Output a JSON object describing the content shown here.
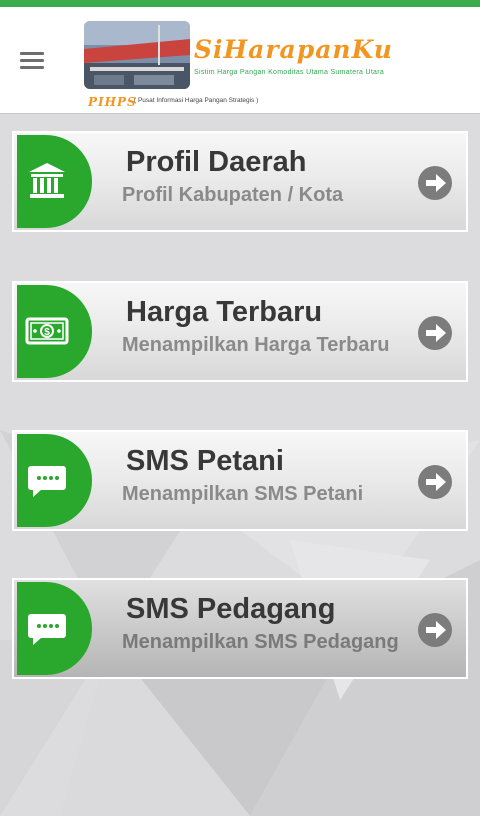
{
  "app": {
    "logo_title": "SiHarapanKu",
    "logo_subtitle": "Sistim Harga Pangan Komoditas Utama Sumatera Utara",
    "logo_pihps": "PIHPS",
    "logo_pihps_desc": "( Pusat Informasi Harga Pangan Strategis )"
  },
  "colors": {
    "accent_green": "#2aa82e",
    "top_bar": "#3dab4a",
    "logo_orange": "#f29622"
  },
  "menu": [
    {
      "title": "Profil Daerah",
      "subtitle": "Profil Kabupaten / Kota",
      "icon": "bank-icon"
    },
    {
      "title": "Harga Terbaru",
      "subtitle": "Menampilkan Harga Terbaru",
      "icon": "money-icon"
    },
    {
      "title": "SMS Petani",
      "subtitle": "Menampilkan SMS Petani",
      "icon": "message-icon"
    },
    {
      "title": "SMS Pedagang",
      "subtitle": "Menampilkan SMS Pedagang",
      "icon": "message-icon"
    }
  ]
}
